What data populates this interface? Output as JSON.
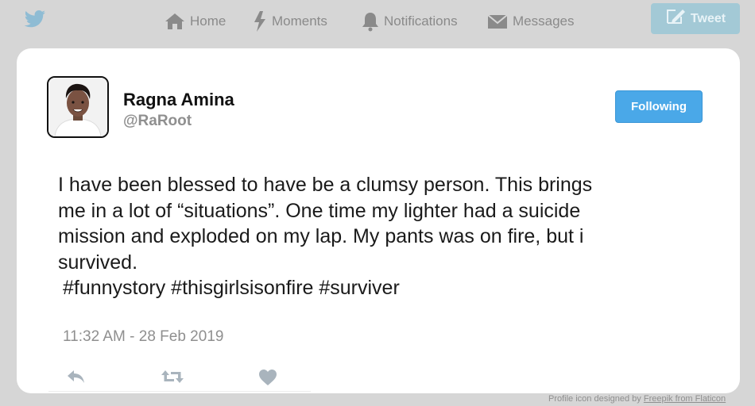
{
  "nav": {
    "home": "Home",
    "moments": "Moments",
    "notifications": "Notifications",
    "messages": "Messages",
    "tweet_button": "Tweet"
  },
  "profile": {
    "name": "Ragna Amina",
    "handle": "@RaRoot",
    "follow_label": "Following"
  },
  "tweet": {
    "lines": [
      "I have been blessed to have be a clumsy person. This brings",
      "me in a lot of “situations”. One time my lighter had a suicide",
      "mission and exploded on my lap. My pants was on fire, but i",
      "survived."
    ],
    "hashtags": "#funnystory #thisgirlsisonfire #surviver",
    "timestamp": "11:32 AM - 28 Feb 2019"
  },
  "attribution": {
    "prefix": "Profile icon designed by ",
    "link": "Freepik from Flaticon"
  },
  "colors": {
    "background": "#d6d6d6",
    "accent": "#4aa8e8",
    "muted": "#8f8f8f"
  },
  "icons": [
    "twitter-bird-icon",
    "home-icon",
    "moments-bolt-icon",
    "notifications-bell-icon",
    "messages-envelope-icon",
    "compose-icon",
    "reply-icon",
    "retweet-icon",
    "like-heart-icon"
  ]
}
